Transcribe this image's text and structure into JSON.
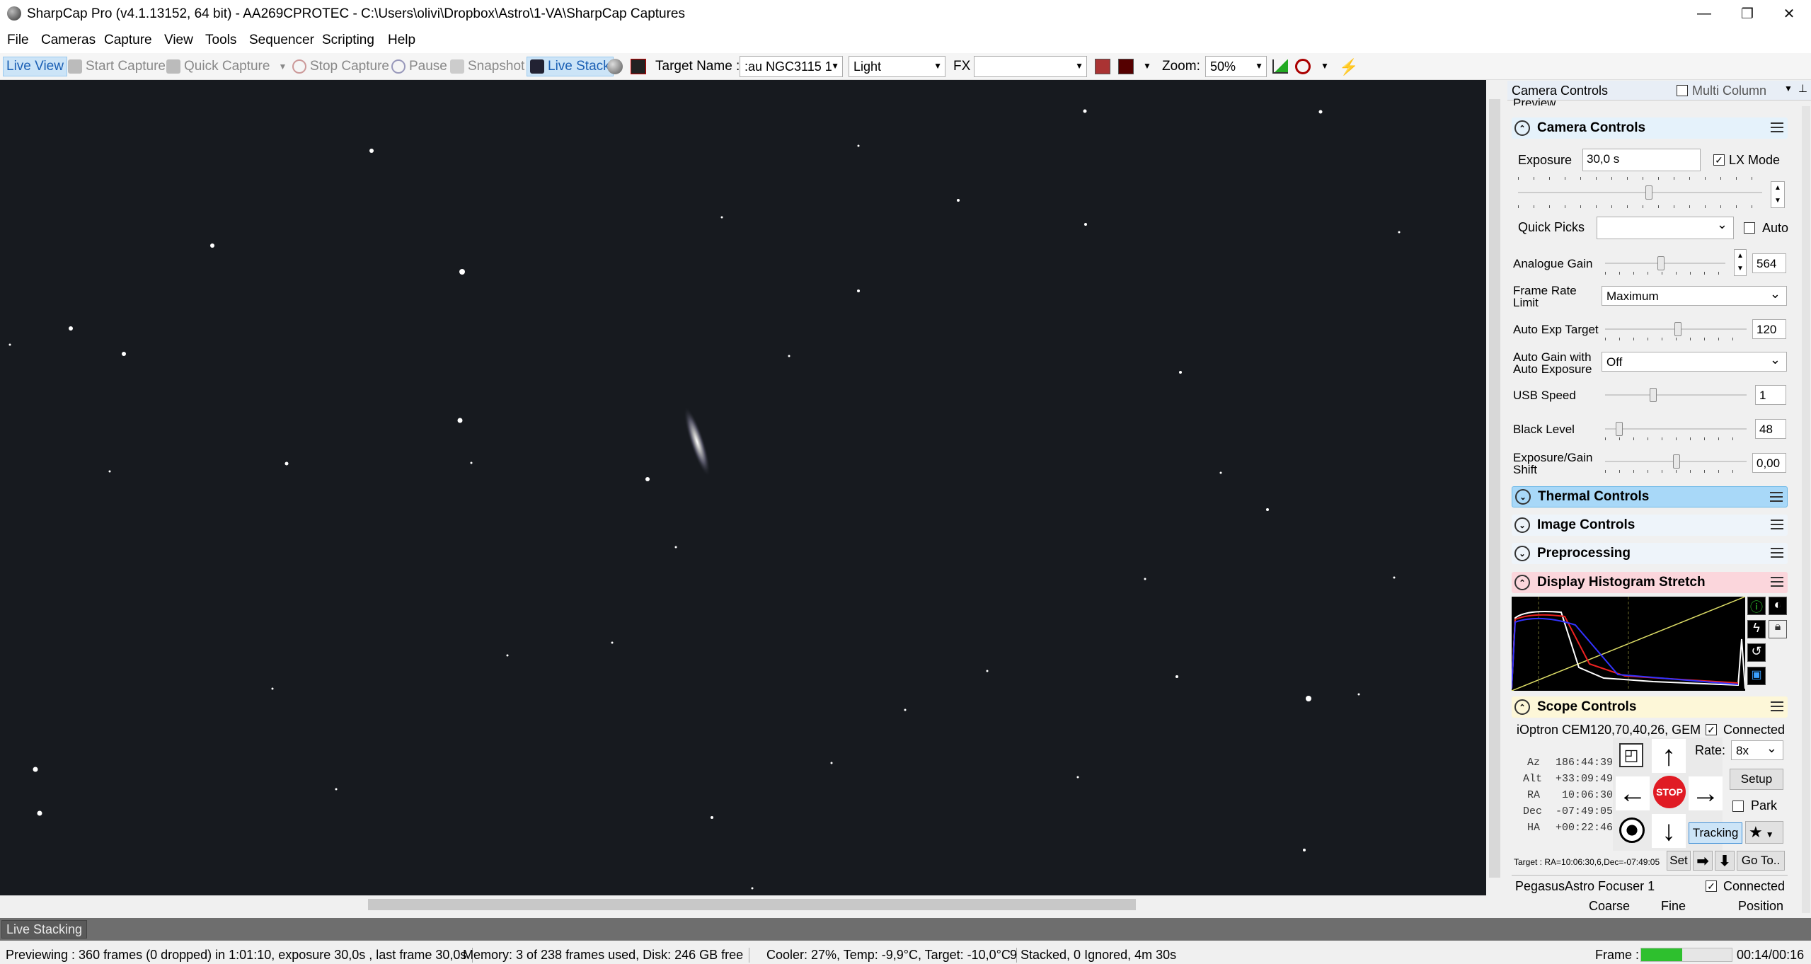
{
  "window": {
    "title": "SharpCap Pro (v4.1.13152, 64 bit) - AA269CPROTEC - C:\\Users\\olivi\\Dropbox\\Astro\\1-VA\\SharpCap Captures",
    "minimize": "—",
    "restore": "❐",
    "close": "✕"
  },
  "menu": [
    "File",
    "Cameras",
    "Capture",
    "View",
    "Tools",
    "Sequencer",
    "Scripting",
    "Help"
  ],
  "toolbar": {
    "live_view": "Live View",
    "start_capture": "Start Capture",
    "quick_capture": "Quick Capture",
    "stop_capture": "Stop Capture",
    "pause": "Pause",
    "snapshot": "Snapshot",
    "live_stack": "Live Stack",
    "target_name_label": "Target Name :",
    "target_name_value": ":au NGC3115 1",
    "frame_type": "Light",
    "fx_label": "FX",
    "fx_value": "",
    "zoom_label": "Zoom:",
    "zoom_value": "50%"
  },
  "panel": {
    "header": "Camera Controls",
    "multi_column": "Multi Column",
    "preview_partial": "Preview",
    "camera_controls": {
      "title": "Camera Controls",
      "exposure_label": "Exposure",
      "exposure_value": "30,0 s",
      "lx_mode": "LX Mode",
      "lx_mode_checked": true,
      "quick_picks_label": "Quick Picks",
      "auto_label": "Auto",
      "analogue_gain_label": "Analogue Gain",
      "analogue_gain_value": "564",
      "frame_rate_label_1": "Frame Rate",
      "frame_rate_label_2": "Limit",
      "frame_rate_value": "Maximum",
      "auto_exp_target_label": "Auto Exp Target",
      "auto_exp_target_value": "120",
      "auto_gain_label_1": "Auto Gain with",
      "auto_gain_label_2": "Auto Exposure",
      "auto_gain_value": "Off",
      "usb_speed_label": "USB Speed",
      "usb_speed_value": "1",
      "black_level_label": "Black Level",
      "black_level_value": "48",
      "exp_gain_shift_label_1": "Exposure/Gain",
      "exp_gain_shift_label_2": "Shift",
      "exp_gain_shift_value": "0,00"
    },
    "sections": {
      "thermal": "Thermal Controls",
      "image": "Image Controls",
      "preprocessing": "Preprocessing",
      "histogram": "Display Histogram Stretch",
      "scope": "Scope Controls"
    },
    "scope": {
      "mount": "iOptron CEM120,70,40,26, GEM",
      "connected": "Connected",
      "rate_label": "Rate:",
      "rate_value": "8x",
      "setup": "Setup",
      "park": "Park",
      "tracking": "Tracking",
      "stop": "STOP",
      "az_label": "Az",
      "az_value": "186:44:39",
      "alt_label": "Alt",
      "alt_value": "+33:09:49",
      "ra_label": "RA",
      "ra_value": "10:06:30",
      "dec_label": "Dec",
      "dec_value": "-07:49:05",
      "ha_label": "HA",
      "ha_value": "+00:22:46",
      "target": "Target : RA=10:06:30,6,Dec=-07:49:05",
      "set": "Set",
      "goto": "Go To.."
    },
    "focuser": {
      "name": "PegasusAstro Focuser 1",
      "connected": "Connected",
      "coarse": "Coarse",
      "fine": "Fine",
      "position": "Position"
    }
  },
  "bottom": {
    "live_stacking_tab": "Live Stacking"
  },
  "status": {
    "previewing": "Previewing : 360 frames (0 dropped) in 1:01:10, exposure 30,0s , last frame 30,0s",
    "memory": "Memory: 3 of 238 frames used, Disk: 246 GB free",
    "cooler": "Cooler: 27%, Temp: -9,9°C, Target: -10,0°C",
    "stacked": "9 Stacked, 0 Ignored, 4m 30s",
    "frame_label": "Frame :",
    "frame_progress": 0.45,
    "time": "00:14/00:16"
  },
  "colors": {
    "accent": "#1a5fb4",
    "camera_header": "#e5f2fb",
    "thermal_header": "#a8d8f8",
    "histogram_header": "#fbd6dc",
    "scope_header": "#fdf7d8",
    "stop_red": "#e01b24",
    "frame_green": "#2ec02e",
    "sky": "#171a1f"
  }
}
